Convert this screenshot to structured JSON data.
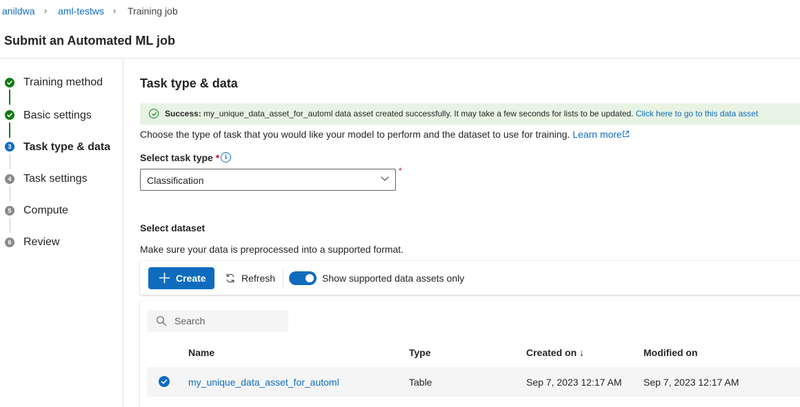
{
  "breadcrumb": {
    "items": [
      "anildwa",
      "aml-testws",
      "Training job"
    ]
  },
  "page": {
    "title": "Submit an Automated ML job"
  },
  "stepper": {
    "steps": [
      {
        "number": "1",
        "label": "Training method",
        "state": "done"
      },
      {
        "number": "2",
        "label": "Basic settings",
        "state": "done"
      },
      {
        "number": "3",
        "label": "Task type & data",
        "state": "current"
      },
      {
        "number": "4",
        "label": "Task settings",
        "state": "todo"
      },
      {
        "number": "5",
        "label": "Compute",
        "state": "todo"
      },
      {
        "number": "6",
        "label": "Review",
        "state": "todo"
      }
    ]
  },
  "main": {
    "section_title": "Task type & data",
    "success": {
      "prefix": "Success:",
      "message": " my_unique_data_asset_for_automl data asset created successfully. It may take a few seconds for lists to be updated. ",
      "link": "Click here to go to this data asset"
    },
    "task_description": "Choose the type of task that you would like your model to perform and the dataset to use for training. ",
    "learn_more": "Learn more",
    "task_type_label": "Select task type",
    "required_mark": "*",
    "task_type_value": "Classification",
    "dataset_label": "Select dataset",
    "dataset_description": "Make sure your data is preprocessed into a supported format."
  },
  "toolbar": {
    "create_label": "Create",
    "refresh_label": "Refresh",
    "toggle_label": "Show supported data assets only",
    "toggle_on": true
  },
  "table": {
    "search_placeholder": "Search",
    "columns": [
      "Name",
      "Type",
      "Created on ↓",
      "Modified on"
    ],
    "rows": [
      {
        "selected": true,
        "name": "my_unique_data_asset_for_automl",
        "type": "Table",
        "created_on": "Sep 7, 2023 12:17 AM",
        "modified_on": "Sep 7, 2023 12:17 AM"
      }
    ]
  },
  "colors": {
    "accent": "#0f6cbd",
    "success": "#107c10",
    "success_bg": "#e7f4e4",
    "required": "#c50f1f"
  }
}
